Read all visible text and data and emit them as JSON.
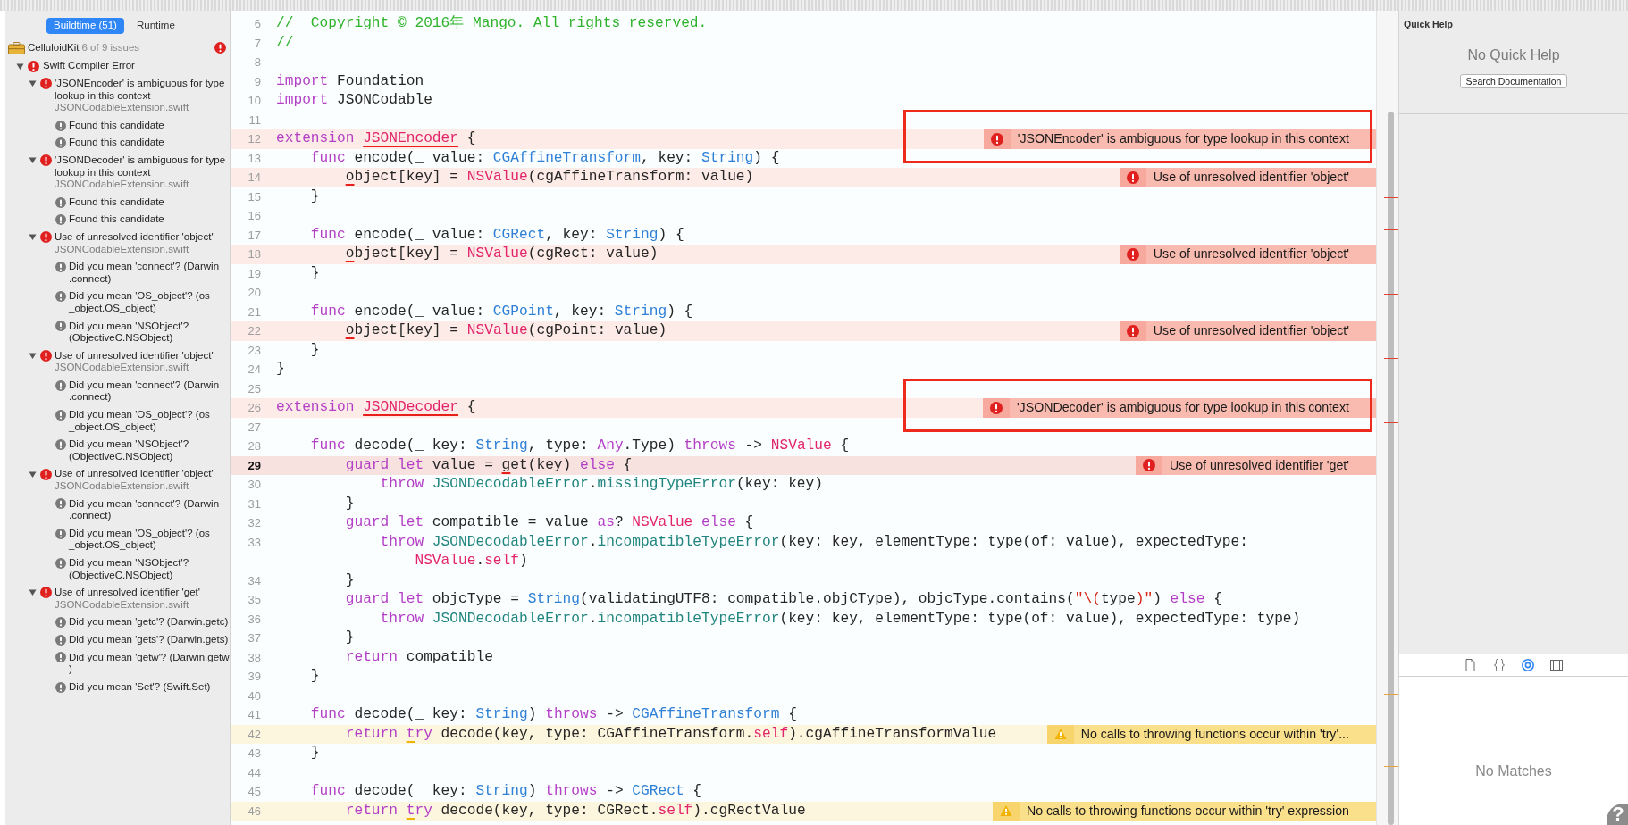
{
  "issue_navigator": {
    "tabs": [
      {
        "label": "Buildtime (51)",
        "selected": true
      },
      {
        "label": "Runtime",
        "selected": false
      }
    ],
    "project": {
      "name": "CelluloidKit",
      "summary": "6 of 9 issues"
    },
    "groups": [
      {
        "label": "Swift Compiler Error",
        "expanded": true,
        "children": [
          {
            "kind": "error",
            "text": "'JSONEncoder' is ambiguous for type\nlookup in this context",
            "file": "JSONCodableExtension.swift",
            "expanded": true,
            "children": [
              {
                "kind": "note",
                "text": "Found this candidate"
              },
              {
                "kind": "note",
                "text": "Found this candidate"
              }
            ]
          },
          {
            "kind": "error",
            "text": "'JSONDecoder' is ambiguous for type\nlookup in this context",
            "file": "JSONCodableExtension.swift",
            "expanded": true,
            "children": [
              {
                "kind": "note",
                "text": "Found this candidate"
              },
              {
                "kind": "note",
                "text": "Found this candidate"
              }
            ]
          },
          {
            "kind": "error",
            "text": "Use of unresolved identifier 'object'",
            "file": "JSONCodableExtension.swift",
            "expanded": true,
            "children": [
              {
                "kind": "note",
                "text": "Did you mean 'connect'? (Darwin\n.connect)"
              },
              {
                "kind": "note",
                "text": "Did you mean 'OS_object'? (os\n_object.OS_object)"
              },
              {
                "kind": "note",
                "text": "Did you mean 'NSObject'?\n(ObjectiveC.NSObject)"
              }
            ]
          },
          {
            "kind": "error",
            "text": "Use of unresolved identifier 'object'",
            "file": "JSONCodableExtension.swift",
            "expanded": true,
            "children": [
              {
                "kind": "note",
                "text": "Did you mean 'connect'? (Darwin\n.connect)"
              },
              {
                "kind": "note",
                "text": "Did you mean 'OS_object'? (os\n_object.OS_object)"
              },
              {
                "kind": "note",
                "text": "Did you mean 'NSObject'?\n(ObjectiveC.NSObject)"
              }
            ]
          },
          {
            "kind": "error",
            "text": "Use of unresolved identifier 'object'",
            "file": "JSONCodableExtension.swift",
            "expanded": true,
            "children": [
              {
                "kind": "note",
                "text": "Did you mean 'connect'? (Darwin\n.connect)"
              },
              {
                "kind": "note",
                "text": "Did you mean 'OS_object'? (os\n_object.OS_object)"
              },
              {
                "kind": "note",
                "text": "Did you mean 'NSObject'?\n(ObjectiveC.NSObject)"
              }
            ]
          },
          {
            "kind": "error",
            "text": "Use of unresolved identifier 'get'",
            "file": "JSONCodableExtension.swift",
            "expanded": true,
            "children": [
              {
                "kind": "note",
                "text": "Did you mean 'getc'? (Darwin.getc)"
              },
              {
                "kind": "note",
                "text": "Did you mean 'gets'? (Darwin.gets)"
              },
              {
                "kind": "note",
                "text": "Did you mean 'getw'? (Darwin.getw\n)"
              },
              {
                "kind": "note",
                "text": "Did you mean 'Set'? (Swift.Set)"
              }
            ]
          }
        ]
      }
    ]
  },
  "editor": {
    "lines": [
      {
        "number": "6",
        "tokens": [
          {
            "text": "//  Copyright © 2016年 Mango. All rights reserved.",
            "kind": "comment"
          }
        ]
      },
      {
        "number": "7",
        "tokens": [
          {
            "text": "//",
            "kind": "comment"
          }
        ]
      },
      {
        "number": "8"
      },
      {
        "number": "9",
        "tokens": [
          {
            "text": "import",
            "kind": "keyword"
          },
          {
            "text": " Foundation",
            "kind": "plain"
          }
        ]
      },
      {
        "number": "10",
        "tokens": [
          {
            "text": "import",
            "kind": "keyword"
          },
          {
            "text": " JSONCodable",
            "kind": "plain"
          }
        ]
      },
      {
        "number": "11"
      },
      {
        "number": "12",
        "issue": {
          "kind": "error",
          "message": "'JSONEncoder' is ambiguous for type lookup in this context",
          "boxed": true
        },
        "tokens": [
          {
            "text": "extension ",
            "kind": "keyword"
          },
          {
            "text": "JSONEncoder",
            "kind": "class",
            "flagged": true
          },
          {
            "text": " {",
            "kind": "plain"
          }
        ]
      },
      {
        "number": "13",
        "tokens": [
          {
            "text": "    func",
            "kind": "keyword"
          },
          {
            "text": " encode(_ value: ",
            "kind": "plain"
          },
          {
            "text": "CGAffineTransform",
            "kind": "type"
          },
          {
            "text": ", key: ",
            "kind": "plain"
          },
          {
            "text": "String",
            "kind": "type"
          },
          {
            "text": ") {",
            "kind": "plain"
          }
        ]
      },
      {
        "number": "14",
        "issue": {
          "kind": "error",
          "message": "Use of unresolved identifier 'object'"
        },
        "tokens": [
          {
            "text": "        o",
            "kind": "plain",
            "flagged": true
          },
          {
            "text": "bject[key] = ",
            "kind": "plain"
          },
          {
            "text": "NSValue",
            "kind": "class"
          },
          {
            "text": "(cgAffineTransform: value)",
            "kind": "plain"
          }
        ]
      },
      {
        "number": "15",
        "tokens": [
          {
            "text": "    }",
            "kind": "plain"
          }
        ]
      },
      {
        "number": "16"
      },
      {
        "number": "17",
        "tokens": [
          {
            "text": "    func",
            "kind": "keyword"
          },
          {
            "text": " encode(_ value: ",
            "kind": "plain"
          },
          {
            "text": "CGRect",
            "kind": "type"
          },
          {
            "text": ", key: ",
            "kind": "plain"
          },
          {
            "text": "String",
            "kind": "type"
          },
          {
            "text": ") {",
            "kind": "plain"
          }
        ]
      },
      {
        "number": "18",
        "issue": {
          "kind": "error",
          "message": "Use of unresolved identifier 'object'"
        },
        "tokens": [
          {
            "text": "        o",
            "kind": "plain",
            "flagged": true
          },
          {
            "text": "bject[key] = ",
            "kind": "plain"
          },
          {
            "text": "NSValue",
            "kind": "class"
          },
          {
            "text": "(cgRect: value)",
            "kind": "plain"
          }
        ]
      },
      {
        "number": "19",
        "tokens": [
          {
            "text": "    }",
            "kind": "plain"
          }
        ]
      },
      {
        "number": "20"
      },
      {
        "number": "21",
        "tokens": [
          {
            "text": "    func",
            "kind": "keyword"
          },
          {
            "text": " encode(_ value: ",
            "kind": "plain"
          },
          {
            "text": "CGPoint",
            "kind": "type"
          },
          {
            "text": ", key: ",
            "kind": "plain"
          },
          {
            "text": "String",
            "kind": "type"
          },
          {
            "text": ") {",
            "kind": "plain"
          }
        ]
      },
      {
        "number": "22",
        "issue": {
          "kind": "error",
          "message": "Use of unresolved identifier 'object'"
        },
        "tokens": [
          {
            "text": "        o",
            "kind": "plain",
            "flagged": true
          },
          {
            "text": "bject[key] = ",
            "kind": "plain"
          },
          {
            "text": "NSValue",
            "kind": "class"
          },
          {
            "text": "(cgPoint: value)",
            "kind": "plain"
          }
        ]
      },
      {
        "number": "23",
        "tokens": [
          {
            "text": "    }",
            "kind": "plain"
          }
        ]
      },
      {
        "number": "24",
        "tokens": [
          {
            "text": "}",
            "kind": "plain"
          }
        ]
      },
      {
        "number": "25"
      },
      {
        "number": "26",
        "issue": {
          "kind": "error",
          "message": "'JSONDecoder' is ambiguous for type lookup in this context",
          "boxed": true
        },
        "tokens": [
          {
            "text": "extension ",
            "kind": "keyword"
          },
          {
            "text": "JSONDecoder",
            "kind": "class",
            "flagged": true
          },
          {
            "text": " {",
            "kind": "plain"
          }
        ]
      },
      {
        "number": "27"
      },
      {
        "number": "28",
        "tokens": [
          {
            "text": "    func",
            "kind": "keyword"
          },
          {
            "text": " decode(_ key: ",
            "kind": "plain"
          },
          {
            "text": "String",
            "kind": "type"
          },
          {
            "text": ", type: ",
            "kind": "plain"
          },
          {
            "text": "Any",
            "kind": "keyword"
          },
          {
            "text": ".Type) ",
            "kind": "plain"
          },
          {
            "text": "throws",
            "kind": "keyword"
          },
          {
            "text": " -> ",
            "kind": "plain"
          },
          {
            "text": "NSValue",
            "kind": "class"
          },
          {
            "text": " {",
            "kind": "plain"
          }
        ]
      },
      {
        "number": "29",
        "current": true,
        "issue": {
          "kind": "error",
          "message": "Use of unresolved identifier 'get'"
        },
        "tokens": [
          {
            "text": "        guard let",
            "kind": "keyword"
          },
          {
            "text": " value = ",
            "kind": "plain"
          },
          {
            "text": "g",
            "kind": "plain",
            "flagged": true
          },
          {
            "text": "et(key) ",
            "kind": "plain"
          },
          {
            "text": "else",
            "kind": "keyword"
          },
          {
            "text": " {",
            "kind": "plain"
          }
        ]
      },
      {
        "number": "30",
        "tokens": [
          {
            "text": "            throw ",
            "kind": "keyword"
          },
          {
            "text": "JSONDecodableError",
            "kind": "project"
          },
          {
            "text": ".",
            "kind": "plain"
          },
          {
            "text": "missingTypeError",
            "kind": "project"
          },
          {
            "text": "(key: key)",
            "kind": "plain"
          }
        ]
      },
      {
        "number": "31",
        "tokens": [
          {
            "text": "        }",
            "kind": "plain"
          }
        ]
      },
      {
        "number": "32",
        "tokens": [
          {
            "text": "        guard let",
            "kind": "keyword"
          },
          {
            "text": " compatible = value ",
            "kind": "plain"
          },
          {
            "text": "as",
            "kind": "keyword"
          },
          {
            "text": "? ",
            "kind": "plain"
          },
          {
            "text": "NSValue ",
            "kind": "class"
          },
          {
            "text": "else",
            "kind": "keyword"
          },
          {
            "text": " {",
            "kind": "plain"
          }
        ]
      },
      {
        "number": "33",
        "tokens": [
          {
            "text": "            throw ",
            "kind": "keyword"
          },
          {
            "text": "JSONDecodableError",
            "kind": "project"
          },
          {
            "text": ".",
            "kind": "plain"
          },
          {
            "text": "incompatibleTypeError",
            "kind": "project"
          },
          {
            "text": "(key: key, elementType: type(of: value), expectedType:",
            "kind": "plain"
          }
        ],
        "continuation": [
          {
            "text": "                NSValue",
            "kind": "class"
          },
          {
            "text": ".",
            "kind": "plain"
          },
          {
            "text": "self",
            "kind": "class"
          },
          {
            "text": ")",
            "kind": "plain"
          }
        ]
      },
      {
        "number": "34",
        "tokens": [
          {
            "text": "        }",
            "kind": "plain"
          }
        ]
      },
      {
        "number": "35",
        "tokens": [
          {
            "text": "        guard let",
            "kind": "keyword"
          },
          {
            "text": " objcType = ",
            "kind": "plain"
          },
          {
            "text": "String",
            "kind": "type"
          },
          {
            "text": "(validatingUTF8: compatible.objCType), objcType.contains(",
            "kind": "plain"
          },
          {
            "text": "\"\\(",
            "kind": "string"
          },
          {
            "text": "type",
            "kind": "plain"
          },
          {
            "text": ")\"",
            "kind": "string"
          },
          {
            "text": ") ",
            "kind": "plain"
          },
          {
            "text": "else",
            "kind": "keyword"
          },
          {
            "text": " {",
            "kind": "plain"
          }
        ]
      },
      {
        "number": "36",
        "tokens": [
          {
            "text": "            throw ",
            "kind": "keyword"
          },
          {
            "text": "JSONDecodableError",
            "kind": "project"
          },
          {
            "text": ".",
            "kind": "plain"
          },
          {
            "text": "incompatibleTypeError",
            "kind": "project"
          },
          {
            "text": "(key: key, elementType: type(of: value), expectedType: type)",
            "kind": "plain"
          }
        ]
      },
      {
        "number": "37",
        "tokens": [
          {
            "text": "        }",
            "kind": "plain"
          }
        ]
      },
      {
        "number": "38",
        "tokens": [
          {
            "text": "        return",
            "kind": "keyword"
          },
          {
            "text": " compatible",
            "kind": "plain"
          }
        ]
      },
      {
        "number": "39",
        "tokens": [
          {
            "text": "    }",
            "kind": "plain"
          }
        ]
      },
      {
        "number": "40"
      },
      {
        "number": "41",
        "tokens": [
          {
            "text": "    func",
            "kind": "keyword"
          },
          {
            "text": " decode(_ key: ",
            "kind": "plain"
          },
          {
            "text": "String",
            "kind": "type"
          },
          {
            "text": ") ",
            "kind": "plain"
          },
          {
            "text": "throws",
            "kind": "keyword"
          },
          {
            "text": " -> ",
            "kind": "plain"
          },
          {
            "text": "CGAffineTransform",
            "kind": "type"
          },
          {
            "text": " {",
            "kind": "plain"
          }
        ]
      },
      {
        "number": "42",
        "issue": {
          "kind": "warning",
          "message": "No calls to throwing functions occur within 'try'..."
        },
        "tokens": [
          {
            "text": "        return ",
            "kind": "keyword"
          },
          {
            "text": "t",
            "kind": "keyword",
            "flagged": true
          },
          {
            "text": "ry",
            "kind": "keyword"
          },
          {
            "text": " decode(key, type: CGAffineTransform.",
            "kind": "plain"
          },
          {
            "text": "self",
            "kind": "class"
          },
          {
            "text": ").cgAffineTransformValue",
            "kind": "plain"
          }
        ]
      },
      {
        "number": "43",
        "tokens": [
          {
            "text": "    }",
            "kind": "plain"
          }
        ]
      },
      {
        "number": "44"
      },
      {
        "number": "45",
        "tokens": [
          {
            "text": "    func",
            "kind": "keyword"
          },
          {
            "text": " decode(_ key: ",
            "kind": "plain"
          },
          {
            "text": "String",
            "kind": "type"
          },
          {
            "text": ") ",
            "kind": "plain"
          },
          {
            "text": "throws",
            "kind": "keyword"
          },
          {
            "text": " -> ",
            "kind": "plain"
          },
          {
            "text": "CGRect",
            "kind": "type"
          },
          {
            "text": " {",
            "kind": "plain"
          }
        ]
      },
      {
        "number": "46",
        "issue": {
          "kind": "warning",
          "message": "No calls to throwing functions occur within 'try' expression"
        },
        "tokens": [
          {
            "text": "        return ",
            "kind": "keyword"
          },
          {
            "text": "t",
            "kind": "keyword",
            "flagged": true
          },
          {
            "text": "ry",
            "kind": "keyword"
          },
          {
            "text": " decode(key, type: CGRect.",
            "kind": "plain"
          },
          {
            "text": "self",
            "kind": "class"
          },
          {
            "text": ").cgRectValue",
            "kind": "plain"
          }
        ]
      }
    ]
  },
  "quick_help": {
    "title": "Quick Help",
    "message": "No Quick Help",
    "button": "Search Documentation"
  },
  "library": {
    "tabs": [
      {
        "kind": "file",
        "selected": false
      },
      {
        "kind": "braces",
        "selected": false
      },
      {
        "kind": "object",
        "selected": true
      },
      {
        "kind": "media",
        "selected": false
      }
    ],
    "message": "No Matches"
  },
  "help_button": "?"
}
